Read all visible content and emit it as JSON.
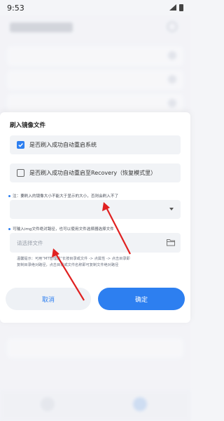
{
  "status_bar": {
    "time": "9:53"
  },
  "dialog": {
    "title": "刷入镜像文件",
    "options": [
      {
        "label": "是否刷入成功自动重启系统",
        "checked": true
      },
      {
        "label": "是否刷入成功自动重启至Recovery（恢复模式里）",
        "checked": false
      }
    ],
    "note_size": "注：要刷入的镜像大小不能大于显示的大小，否则会刷入不了",
    "note_path": "可输入img文件绝对路径，也可以使用文件选择器选择文件",
    "select_value": "",
    "file_input": {
      "placeholder": "请选择文件",
      "value": ""
    },
    "tip_lines": [
      "温馨提示：可用“MT管理器”长按目录或文件 -> 点属性 -> 点击目录即",
      "复制目录绝对路径，点击目录或文件名称即可复制文件绝对路径"
    ],
    "cancel_label": "取消",
    "ok_label": "确定"
  },
  "colors": {
    "accent": "#2d7ff0",
    "annotation_arrow": "#e02020"
  },
  "icons": {
    "check": "check-icon",
    "dropdown": "chevron-down-icon",
    "folder": "folder-icon"
  }
}
